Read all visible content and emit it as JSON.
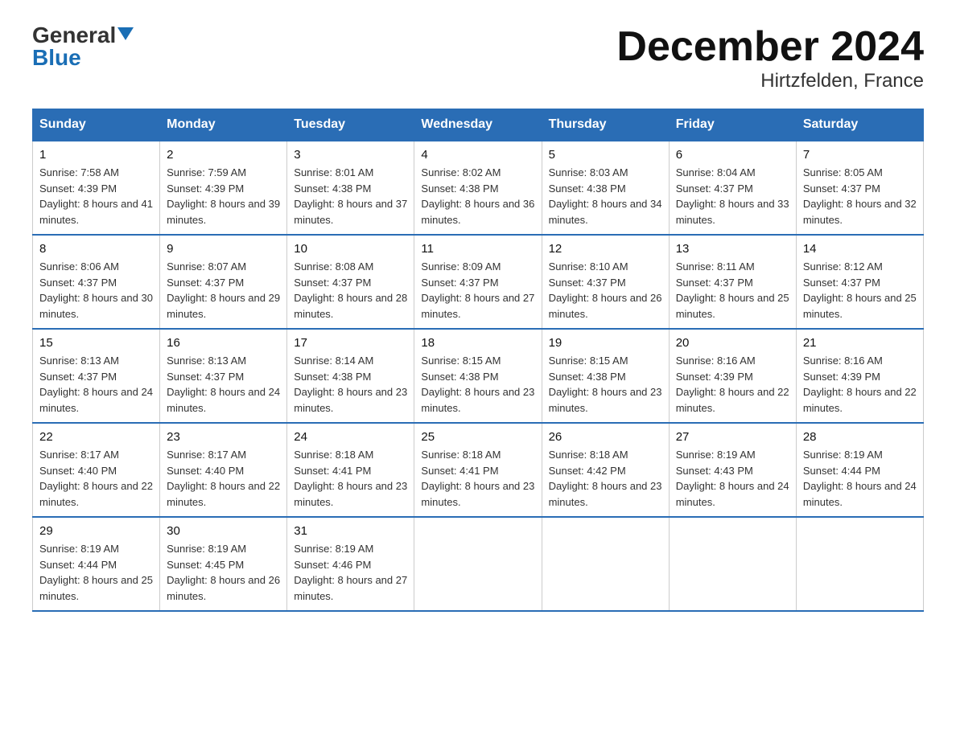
{
  "logo": {
    "general": "General",
    "blue": "Blue"
  },
  "title": "December 2024",
  "subtitle": "Hirtzfelden, France",
  "days": [
    "Sunday",
    "Monday",
    "Tuesday",
    "Wednesday",
    "Thursday",
    "Friday",
    "Saturday"
  ],
  "weeks": [
    [
      {
        "num": "1",
        "sunrise": "7:58 AM",
        "sunset": "4:39 PM",
        "daylight": "8 hours and 41 minutes."
      },
      {
        "num": "2",
        "sunrise": "7:59 AM",
        "sunset": "4:39 PM",
        "daylight": "8 hours and 39 minutes."
      },
      {
        "num": "3",
        "sunrise": "8:01 AM",
        "sunset": "4:38 PM",
        "daylight": "8 hours and 37 minutes."
      },
      {
        "num": "4",
        "sunrise": "8:02 AM",
        "sunset": "4:38 PM",
        "daylight": "8 hours and 36 minutes."
      },
      {
        "num": "5",
        "sunrise": "8:03 AM",
        "sunset": "4:38 PM",
        "daylight": "8 hours and 34 minutes."
      },
      {
        "num": "6",
        "sunrise": "8:04 AM",
        "sunset": "4:37 PM",
        "daylight": "8 hours and 33 minutes."
      },
      {
        "num": "7",
        "sunrise": "8:05 AM",
        "sunset": "4:37 PM",
        "daylight": "8 hours and 32 minutes."
      }
    ],
    [
      {
        "num": "8",
        "sunrise": "8:06 AM",
        "sunset": "4:37 PM",
        "daylight": "8 hours and 30 minutes."
      },
      {
        "num": "9",
        "sunrise": "8:07 AM",
        "sunset": "4:37 PM",
        "daylight": "8 hours and 29 minutes."
      },
      {
        "num": "10",
        "sunrise": "8:08 AM",
        "sunset": "4:37 PM",
        "daylight": "8 hours and 28 minutes."
      },
      {
        "num": "11",
        "sunrise": "8:09 AM",
        "sunset": "4:37 PM",
        "daylight": "8 hours and 27 minutes."
      },
      {
        "num": "12",
        "sunrise": "8:10 AM",
        "sunset": "4:37 PM",
        "daylight": "8 hours and 26 minutes."
      },
      {
        "num": "13",
        "sunrise": "8:11 AM",
        "sunset": "4:37 PM",
        "daylight": "8 hours and 25 minutes."
      },
      {
        "num": "14",
        "sunrise": "8:12 AM",
        "sunset": "4:37 PM",
        "daylight": "8 hours and 25 minutes."
      }
    ],
    [
      {
        "num": "15",
        "sunrise": "8:13 AM",
        "sunset": "4:37 PM",
        "daylight": "8 hours and 24 minutes."
      },
      {
        "num": "16",
        "sunrise": "8:13 AM",
        "sunset": "4:37 PM",
        "daylight": "8 hours and 24 minutes."
      },
      {
        "num": "17",
        "sunrise": "8:14 AM",
        "sunset": "4:38 PM",
        "daylight": "8 hours and 23 minutes."
      },
      {
        "num": "18",
        "sunrise": "8:15 AM",
        "sunset": "4:38 PM",
        "daylight": "8 hours and 23 minutes."
      },
      {
        "num": "19",
        "sunrise": "8:15 AM",
        "sunset": "4:38 PM",
        "daylight": "8 hours and 23 minutes."
      },
      {
        "num": "20",
        "sunrise": "8:16 AM",
        "sunset": "4:39 PM",
        "daylight": "8 hours and 22 minutes."
      },
      {
        "num": "21",
        "sunrise": "8:16 AM",
        "sunset": "4:39 PM",
        "daylight": "8 hours and 22 minutes."
      }
    ],
    [
      {
        "num": "22",
        "sunrise": "8:17 AM",
        "sunset": "4:40 PM",
        "daylight": "8 hours and 22 minutes."
      },
      {
        "num": "23",
        "sunrise": "8:17 AM",
        "sunset": "4:40 PM",
        "daylight": "8 hours and 22 minutes."
      },
      {
        "num": "24",
        "sunrise": "8:18 AM",
        "sunset": "4:41 PM",
        "daylight": "8 hours and 23 minutes."
      },
      {
        "num": "25",
        "sunrise": "8:18 AM",
        "sunset": "4:41 PM",
        "daylight": "8 hours and 23 minutes."
      },
      {
        "num": "26",
        "sunrise": "8:18 AM",
        "sunset": "4:42 PM",
        "daylight": "8 hours and 23 minutes."
      },
      {
        "num": "27",
        "sunrise": "8:19 AM",
        "sunset": "4:43 PM",
        "daylight": "8 hours and 24 minutes."
      },
      {
        "num": "28",
        "sunrise": "8:19 AM",
        "sunset": "4:44 PM",
        "daylight": "8 hours and 24 minutes."
      }
    ],
    [
      {
        "num": "29",
        "sunrise": "8:19 AM",
        "sunset": "4:44 PM",
        "daylight": "8 hours and 25 minutes."
      },
      {
        "num": "30",
        "sunrise": "8:19 AM",
        "sunset": "4:45 PM",
        "daylight": "8 hours and 26 minutes."
      },
      {
        "num": "31",
        "sunrise": "8:19 AM",
        "sunset": "4:46 PM",
        "daylight": "8 hours and 27 minutes."
      },
      null,
      null,
      null,
      null
    ]
  ]
}
